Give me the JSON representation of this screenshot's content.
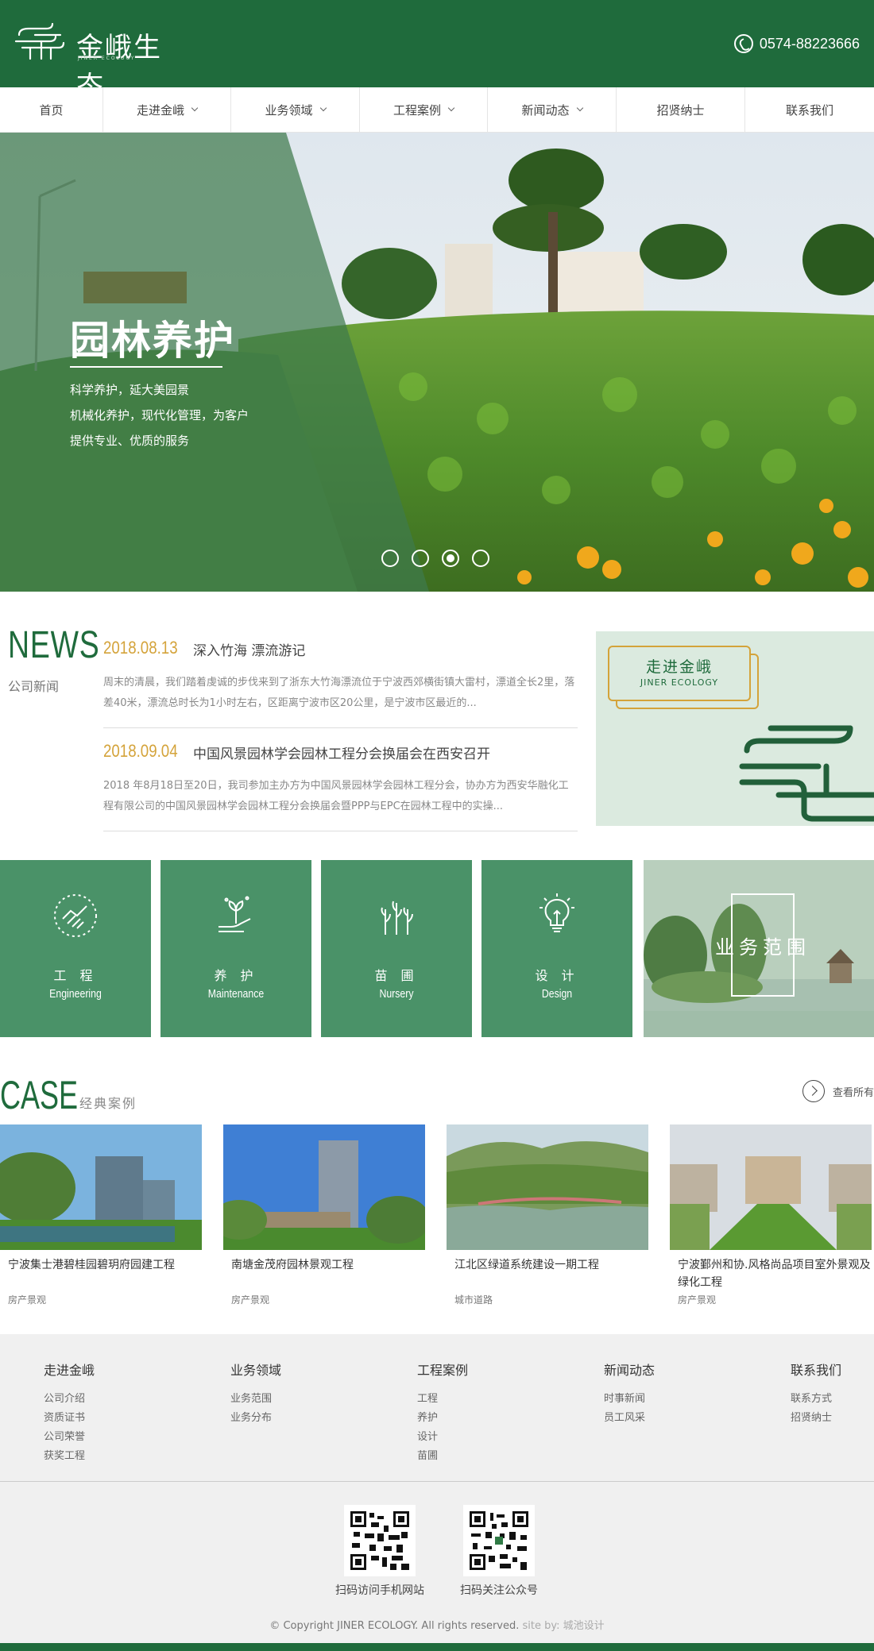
{
  "brand": {
    "name": "金峨生态",
    "sub": "JINER ECOLOGY"
  },
  "header": {
    "phone": "0574-88223666"
  },
  "nav": [
    {
      "label": "首页",
      "dropdown": false
    },
    {
      "label": "走进金峨",
      "dropdown": true
    },
    {
      "label": "业务领域",
      "dropdown": true
    },
    {
      "label": "工程案例",
      "dropdown": true
    },
    {
      "label": "新闻动态",
      "dropdown": true
    },
    {
      "label": "招贤纳士",
      "dropdown": false
    },
    {
      "label": "联系我们",
      "dropdown": false
    }
  ],
  "hero": {
    "title": "园林养护",
    "desc": "科学养护，延大美园景\n机械化养护，现代化管理，为客户\n提供专业、优质的服务",
    "active_slide": 3,
    "slide_count": 4
  },
  "news": {
    "en": "NEWS",
    "cn": "公司新闻",
    "items": [
      {
        "date": "2018.08.13",
        "title": "深入竹海 漂流游记",
        "summary": "周末的清晨，我们踏着虔诚的步伐来到了浙东大竹海漂流位于宁波西郊横街镇大雷村，漂道全长2里，落差40米，漂流总时长为1小时左右，区距离宁波市区20公里，是宁波市区最近的..."
      },
      {
        "date": "2018.09.04",
        "title": "中国风景园林学会园林工程分会换届会在西安召开",
        "summary": "2018 年8月18日至20日，我司参加主办方为中国风景园林学会园林工程分会，协办方为西安华融化工程有限公司的中国风景园林学会园林工程分会换届会暨PPP与EPC在园林工程中的实操..."
      }
    ]
  },
  "about": {
    "cn": "走进金峨",
    "en": "JINER ECOLOGY"
  },
  "services": {
    "items": [
      {
        "cn": "工 程",
        "en": "Engineering",
        "icon": "handshake-icon"
      },
      {
        "cn": "养 护",
        "en": "Maintenance",
        "icon": "plant-hand-icon"
      },
      {
        "cn": "苗 圃",
        "en": "Nursery",
        "icon": "seedling-icon"
      },
      {
        "cn": "设 计",
        "en": "Design",
        "icon": "lightbulb-icon"
      }
    ],
    "scope_label": "业务范围"
  },
  "cases": {
    "en": "CASE",
    "cn": "经典案例",
    "more": "查看所有",
    "items": [
      {
        "title": "宁波集士港碧桂园碧玥府园建工程",
        "category": "房产景观"
      },
      {
        "title": "南塘金茂府园林景观工程",
        "category": "房产景观"
      },
      {
        "title": "江北区绿道系统建设一期工程",
        "category": "城市道路"
      },
      {
        "title": "宁波鄞州和协.风格尚品项目室外景观及绿化工程",
        "category": "房产景观"
      }
    ]
  },
  "footer": {
    "columns": [
      {
        "title": "走进金峨",
        "links": [
          "公司介绍",
          "资质证书",
          "公司荣誉",
          "获奖工程"
        ]
      },
      {
        "title": "业务领域",
        "links": [
          "业务范围",
          "业务分布"
        ]
      },
      {
        "title": "工程案例",
        "links": [
          "工程",
          "养护",
          "设计",
          "苗圃"
        ]
      },
      {
        "title": "新闻动态",
        "links": [
          "时事新闻",
          "员工风采"
        ]
      },
      {
        "title": "联系我们",
        "links": [
          "联系方式",
          "招贤纳士"
        ]
      }
    ],
    "qr": [
      {
        "caption": "扫码访问手机网站"
      },
      {
        "caption": "扫码关注公众号"
      }
    ],
    "copyright": "© Copyright JINER ECOLOGY. All rights reserved.",
    "siteby": "site by: 城池设计"
  },
  "colors": {
    "primary": "#1f6b3c",
    "service": "#4a9268",
    "accent": "#d4a33a"
  }
}
